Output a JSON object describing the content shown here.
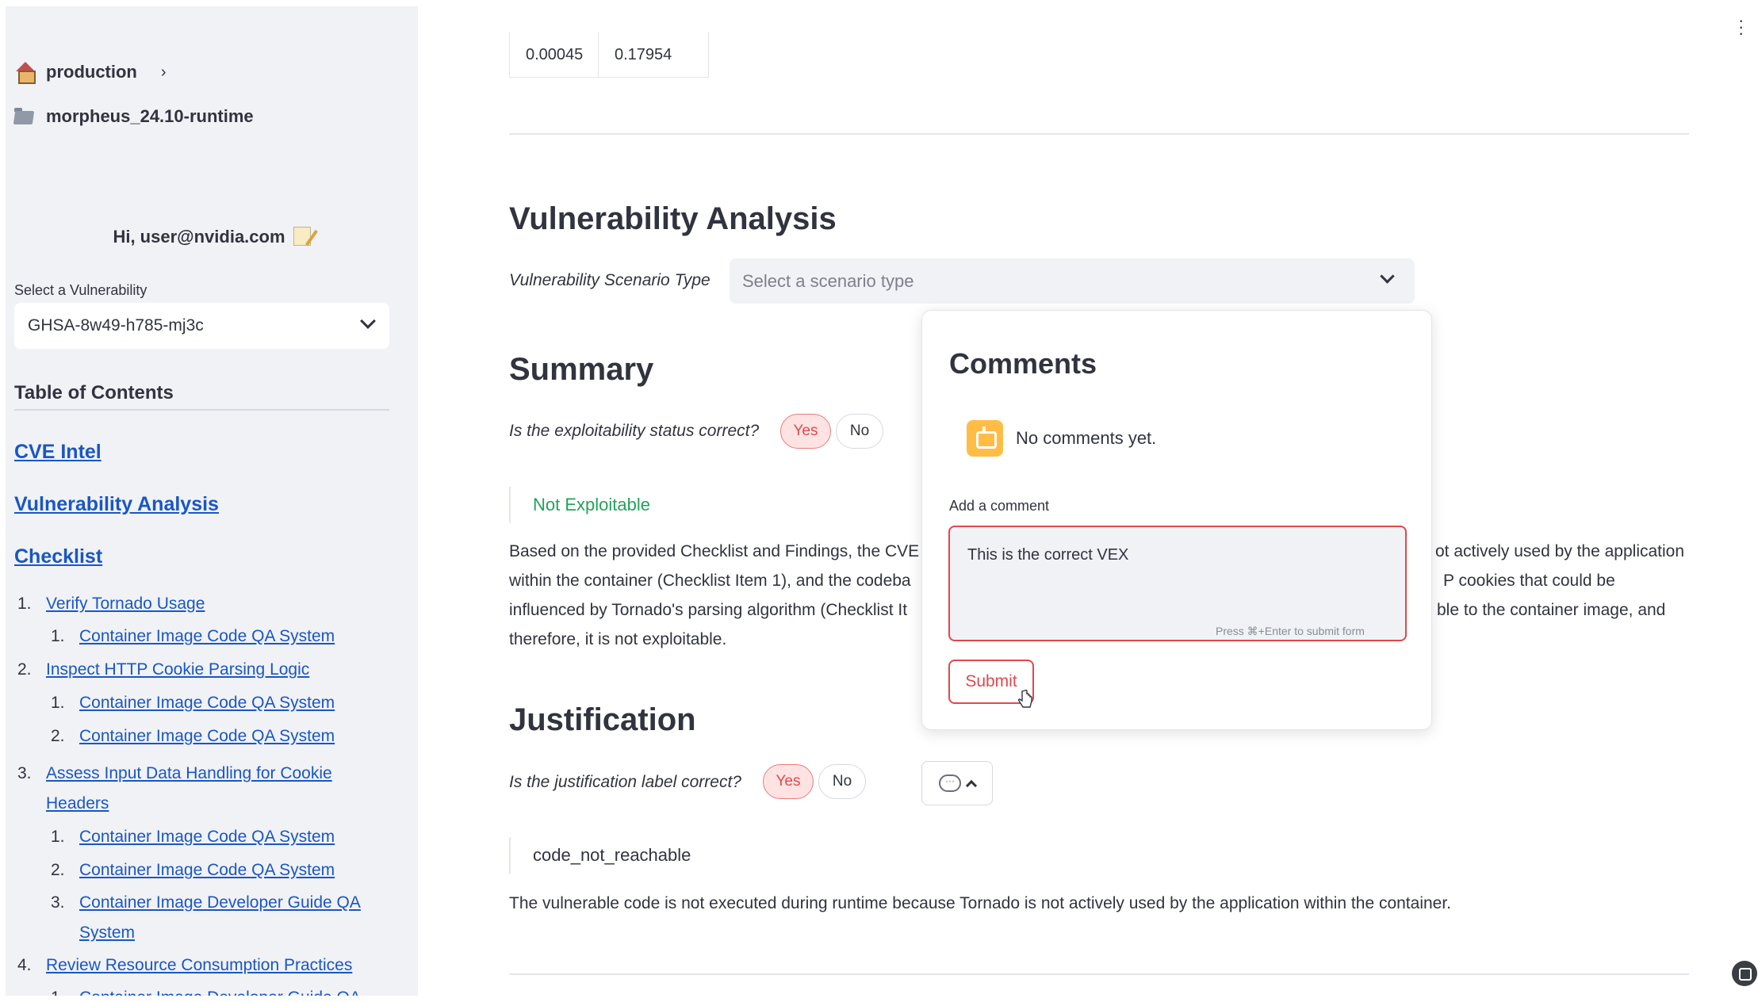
{
  "sidebar": {
    "project": "production",
    "container": "morpheus_24.10-runtime",
    "greeting": "Hi, user@nvidia.com",
    "select_label": "Select a Vulnerability",
    "selected_vulnerability": "GHSA-8w49-h785-mj3c",
    "toc_title": "Table of Contents",
    "toc_sections": [
      "CVE Intel",
      "Vulnerability Analysis",
      "Checklist"
    ],
    "checklist": [
      {
        "num": "1.",
        "label": "Verify Tornado Usage",
        "subs": [
          "Container Image Code QA System"
        ]
      },
      {
        "num": "2.",
        "label": "Inspect HTTP Cookie Parsing Logic",
        "subs": [
          "Container Image Code QA System",
          "Container Image Code QA System"
        ]
      },
      {
        "num": "3.",
        "label_line1": "Assess Input Data Handling for Cookie",
        "label_line2": "Headers",
        "subs": [
          "Container Image Code QA System",
          "Container Image Code QA System"
        ],
        "sub3_line1": "Container Image Developer Guide QA",
        "sub3_line2": "System"
      },
      {
        "num": "4.",
        "label": "Review Resource Consumption Practices",
        "subs": [
          "Container Image Developer Guide QA"
        ]
      }
    ],
    "sub_nums": [
      "1.",
      "2.",
      "3."
    ]
  },
  "main": {
    "table_cells": [
      "0.00045",
      "0.17954"
    ],
    "section_title": "Vulnerability Analysis",
    "scenario_label": "Vulnerability Scenario Type",
    "scenario_placeholder": "Select a scenario type",
    "summary": {
      "title": "Summary",
      "question": "Is the exploitability status correct?",
      "yes": "Yes",
      "no": "No",
      "status": "Not Exploitable",
      "status_color": "#21a35a",
      "text_line1a": "Based on the provided Checklist and Findings, the CVE",
      "text_line1b": "ot actively used by the application",
      "text_line2a": "within the container (Checklist Item 1), and the codeba",
      "text_line2b": "P cookies that could be",
      "text_line3a": "influenced by Tornado's parsing algorithm (Checklist It",
      "text_line3b": "ble to the container image, and",
      "text_line4": "therefore, it is not exploitable."
    },
    "justification": {
      "title": "Justification",
      "question": "Is the justification label correct?",
      "yes": "Yes",
      "no": "No",
      "label": "code_not_reachable",
      "text": "The vulnerable code is not executed during runtime because Tornado is not actively used by the application within the container."
    }
  },
  "comments": {
    "title": "Comments",
    "empty": "No comments yet.",
    "add_label": "Add a comment",
    "value": "This is the correct VEX",
    "hint": "Press ⌘+Enter to submit form",
    "submit": "Submit"
  },
  "colors": {
    "accent": "#e0484b",
    "link": "#1a56c4",
    "sidebar_bg": "#f0f2f6"
  }
}
